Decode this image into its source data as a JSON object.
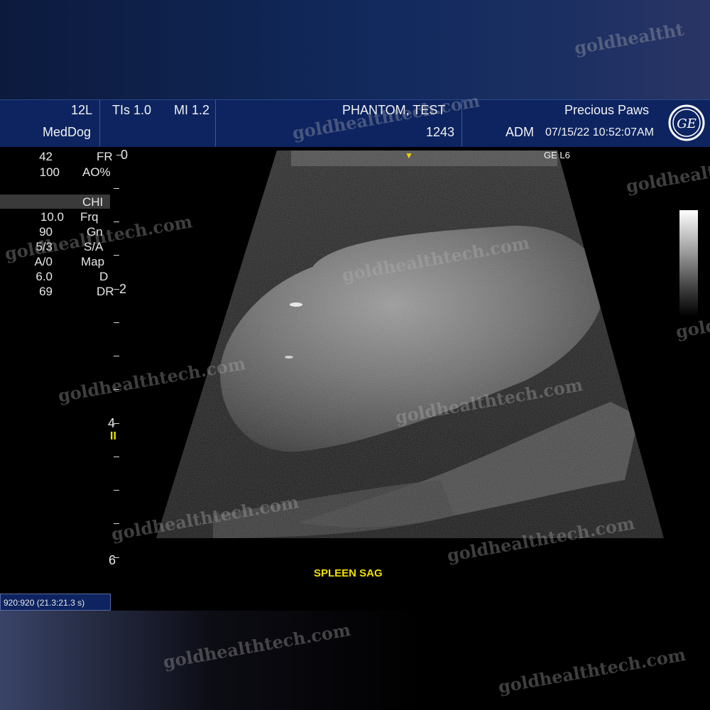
{
  "header": {
    "probe": "12L",
    "tis": "TIs 1.0",
    "mi": "MI 1.2",
    "preset": "MedDog",
    "patient_name": "PHANTOM, TEST",
    "patient_id": "1243",
    "clinic": "Precious Paws",
    "operator": "ADM",
    "datetime": "07/15/22 10:52:07AM",
    "brand_glyph": "GE",
    "ge_depth_note": "GE L6"
  },
  "params_top": [
    {
      "label": "FR",
      "value": "42"
    },
    {
      "label": "AO%",
      "value": "100"
    }
  ],
  "mode_label": "CHI",
  "params": [
    {
      "label": "Frq",
      "value": "10.0"
    },
    {
      "label": "Gn",
      "value": "90"
    },
    {
      "label": "S/A",
      "value": "5/3"
    },
    {
      "label": "Map",
      "value": "A/0"
    },
    {
      "label": "D",
      "value": "6.0"
    },
    {
      "label": "DR",
      "value": "69"
    }
  ],
  "depth_scale": {
    "labels": [
      {
        "text": "0",
        "value": 0
      },
      {
        "text": "2",
        "value": 2
      },
      {
        "text": "4",
        "value": 4
      },
      {
        "text": "6",
        "value": 6
      }
    ],
    "max_depth": 6
  },
  "focus_marker": "II",
  "scan_label": "SPLEEN SAG",
  "frame_info": "920:920 (21.3:21.3 s)",
  "watermarks": [
    "goldhealtht",
    "goldhealthtech.com",
    "goldhealthtech.com",
    "goldhealthtech.com",
    "goldhealthtech.com",
    "goldhealthtech.com",
    "goldhealthtech.com",
    "goldhealthtech.com",
    "goldhealthtech.com",
    "goldhealthtech.com",
    "goldhealthtech.com",
    "goldhealthtech.com",
    "goldhealthtech.com"
  ],
  "colors": {
    "header_bg": "#0d2460",
    "accent_yellow": "#f0e000"
  }
}
